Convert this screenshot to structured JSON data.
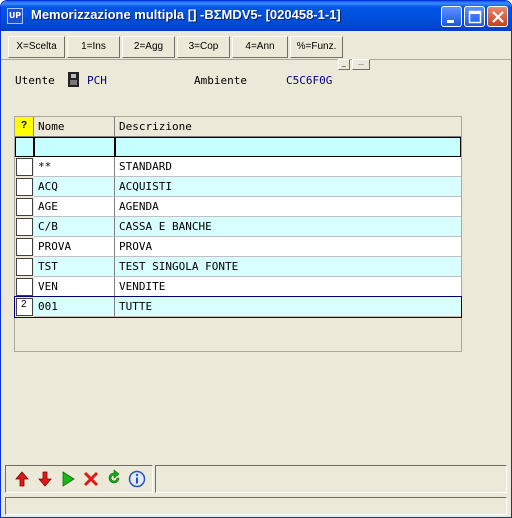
{
  "window": {
    "app_icon_text": "UP",
    "title": "Memorizzazione multipla [] -BΣMDV5- [020458-1-1]"
  },
  "fkeys": [
    {
      "label": "X=Scelta"
    },
    {
      "label": "1=Ins"
    },
    {
      "label": "2=Agg"
    },
    {
      "label": "3=Cop"
    },
    {
      "label": "4=Ann"
    },
    {
      "label": "%=Funz."
    }
  ],
  "mini_buttons": [
    "_",
    "..."
  ],
  "info": {
    "utente_label": "Utente",
    "utente_value": "PCH",
    "ambiente_label": "Ambiente",
    "ambiente_value": "C5C6F0G"
  },
  "grid": {
    "header": {
      "sel": "?",
      "nome": "Nome",
      "descrizione": "Descrizione"
    },
    "rows": [
      {
        "sel": "",
        "nome": "",
        "descrizione": ""
      },
      {
        "sel": "",
        "nome": "**",
        "descrizione": "STANDARD"
      },
      {
        "sel": "",
        "nome": "ACQ",
        "descrizione": "ACQUISTI"
      },
      {
        "sel": "",
        "nome": "AGE",
        "descrizione": "AGENDA"
      },
      {
        "sel": "",
        "nome": "C/B",
        "descrizione": "CASSA E BANCHE"
      },
      {
        "sel": "",
        "nome": "PROVA",
        "descrizione": "PROVA"
      },
      {
        "sel": "",
        "nome": "TST",
        "descrizione": "TEST SINGOLA FONTE"
      },
      {
        "sel": "",
        "nome": "VEN",
        "descrizione": "VENDITE"
      },
      {
        "sel": "2",
        "nome": "001",
        "descrizione": "TUTTE"
      }
    ]
  },
  "toolbar_icons": [
    "arrow-up-icon",
    "arrow-down-icon",
    "play-icon",
    "delete-icon",
    "refresh-icon",
    "info-icon"
  ],
  "colors": {
    "titlebar": "#0055e5",
    "row_cyan": "#d7ffff",
    "value_text": "#00008b",
    "header_marker": "#ffff00"
  }
}
